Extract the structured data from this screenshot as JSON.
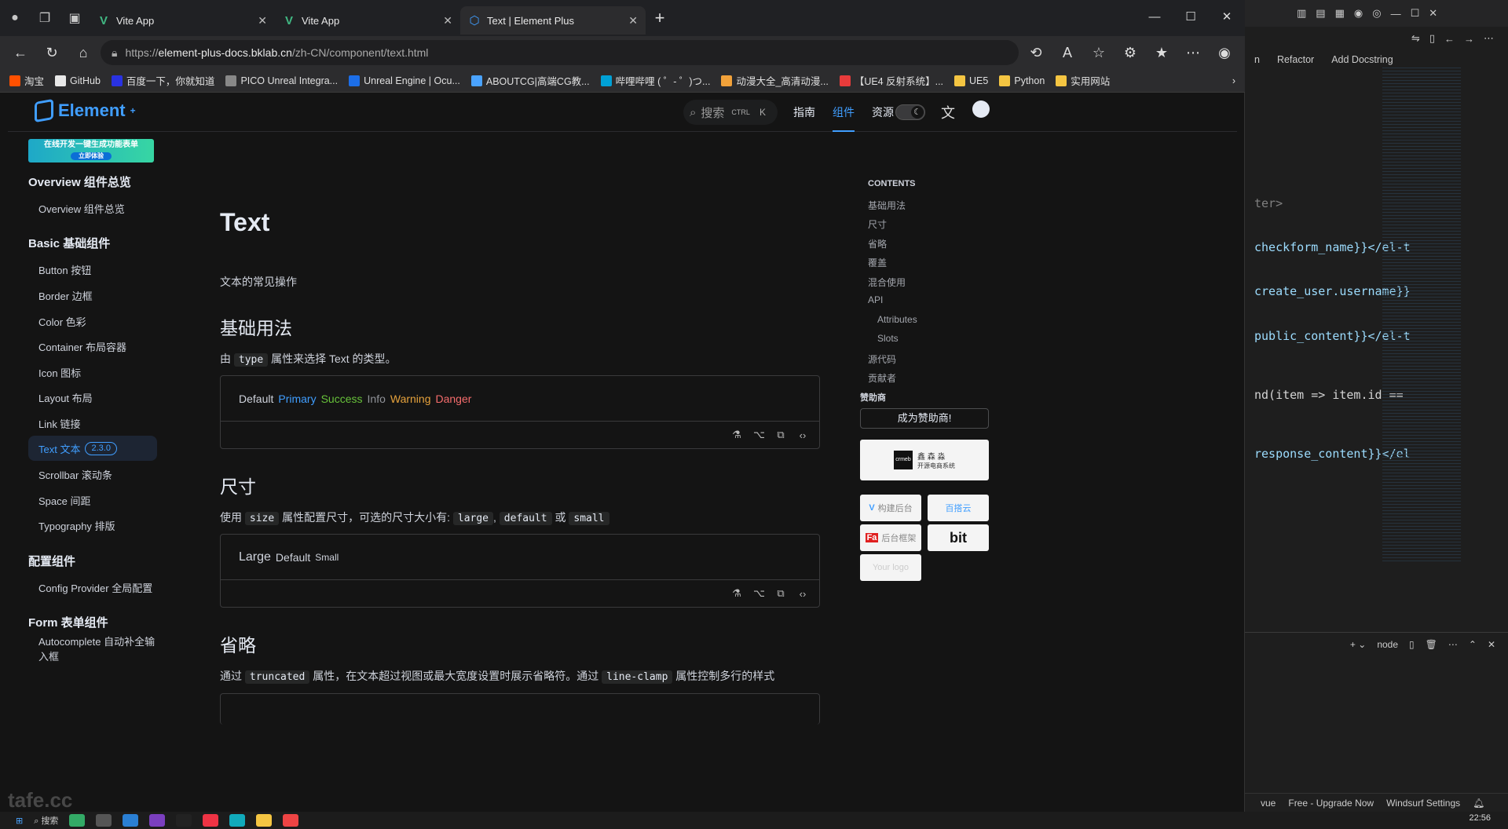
{
  "browser": {
    "tabs": [
      {
        "label": "Vite App"
      },
      {
        "label": "Vite App"
      },
      {
        "label": "Text | Element Plus"
      }
    ],
    "url_prefix": "https://",
    "url_host": "element-plus-docs.bklab.cn",
    "url_path": "/zh-CN/component/text.html",
    "bookmarks": [
      {
        "label": "淘宝",
        "color": "#ff5000"
      },
      {
        "label": "GitHub",
        "color": "#e8e8e8"
      },
      {
        "label": "百度一下，你就知道",
        "color": "#2932e1"
      },
      {
        "label": "PICO Unreal Integra...",
        "color": "#888888"
      },
      {
        "label": "Unreal Engine | Ocu...",
        "color": "#1c6ee8"
      },
      {
        "label": "ABOUTCG|高端CG教...",
        "color": "#4aa3ff"
      },
      {
        "label": "哔哩哔哩 ( ゜- ゜)つ...",
        "color": "#00a1d6"
      },
      {
        "label": "动漫大全_高清动漫...",
        "color": "#f2a23a"
      },
      {
        "label": "【UE4 反射系统】...",
        "color": "#e83b3b"
      },
      {
        "label": "UE5",
        "color": "#f4c542"
      },
      {
        "label": "Python",
        "color": "#f4c542"
      },
      {
        "label": "实用网站",
        "color": "#f4c542"
      }
    ]
  },
  "site": {
    "logo": "Element",
    "search_placeholder": "搜索",
    "search_kbd1": "CTRL",
    "search_kbd2": "K",
    "nav": {
      "guide": "指南",
      "component": "组件",
      "resource": "资源"
    },
    "ad_line1": "在线开发一键生成功能表单",
    "ad_line2": "立即体验",
    "sidebar": {
      "g_overview": "Overview 组件总览",
      "overview": "Overview 组件总览",
      "g_basic": "Basic 基础组件",
      "button": "Button 按钮",
      "border": "Border 边框",
      "color": "Color 色彩",
      "container": "Container 布局容器",
      "icon": "Icon 图标",
      "layout": "Layout 布局",
      "link": "Link 链接",
      "text": "Text 文本",
      "text_badge": "2.3.0",
      "scrollbar": "Scrollbar 滚动条",
      "space": "Space 间距",
      "typography": "Typography 排版",
      "g_config": "配置组件",
      "config_provider": "Config Provider 全局配置",
      "g_form": "Form 表单组件",
      "autocomplete": "Autocomplete 自动补全输入框"
    },
    "main": {
      "title": "Text",
      "subtitle": "文本的常见操作",
      "basic_title": "基础用法",
      "basic_desc_pre": "由",
      "basic_desc_code": "type",
      "basic_desc_post": "属性来选择 Text 的类型。",
      "types": [
        {
          "label": "Default",
          "color": "#cfd3dc"
        },
        {
          "label": "Primary",
          "color": "#409eff"
        },
        {
          "label": "Success",
          "color": "#67c23a"
        },
        {
          "label": "Info",
          "color": "#909399"
        },
        {
          "label": "Warning",
          "color": "#e6a23c"
        },
        {
          "label": "Danger",
          "color": "#f56c6c"
        }
      ],
      "size_title": "尺寸",
      "size_desc_pre": "使用",
      "size_desc_code": "size",
      "size_desc_mid": "属性配置尺寸，可选的尺寸大小有:",
      "size_code1": "large",
      "size_code2": "default",
      "size_or": "或",
      "size_code3": "small",
      "size_large": "Large",
      "size_default": "Default",
      "size_small": "Small",
      "ellipsis_title": "省略",
      "ellipsis_pre": "通过",
      "ellipsis_code1": "truncated",
      "ellipsis_mid": "属性，在文本超过视图或最大宽度设置时展示省略符。通过",
      "ellipsis_code2": "line-clamp",
      "ellipsis_post": "属性控制多行的样式"
    },
    "toc": {
      "heading": "CONTENTS",
      "items": [
        "基础用法",
        "尺寸",
        "省略",
        "覆盖",
        "混合使用",
        "API",
        "Attributes",
        "Slots",
        "源代码",
        "贡献者"
      ]
    },
    "sponsor": {
      "label": "赞助商",
      "become": "成为赞助商!",
      "sp1_title": "鑫 森 淼",
      "sp1_sub": "开源电商系统",
      "sp2": "构建后台",
      "sp3": "百搭云",
      "sp4": "后台框架",
      "sp5": "bit",
      "sp6": "Your logo"
    }
  },
  "vscode": {
    "menu1": "n",
    "menu2": "Refactor",
    "menu3": "Add Docstring",
    "lines": [
      {
        "code": "ter>"
      },
      {
        "code": "checkform_name}}</el-t"
      },
      {
        "code": "create_user.username}}"
      },
      {
        "code": "public_content}}</el-t"
      },
      {
        "code": "nd(item => item.id =="
      },
      {
        "code": "response_content}}</el"
      }
    ],
    "terminal_label": "node",
    "status": [
      "vue",
      "Free - Upgrade Now",
      "Windsurf Settings"
    ]
  },
  "taskbar": {
    "search": "搜索",
    "clock": "22:56"
  },
  "watermark": "tafe.cc"
}
